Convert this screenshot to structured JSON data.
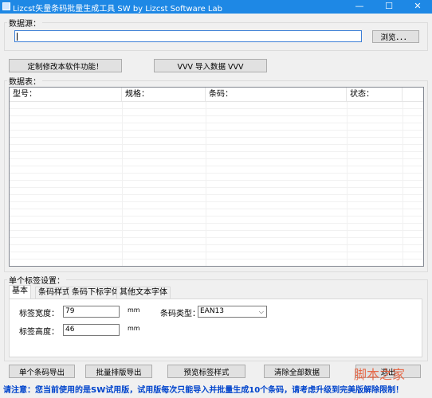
{
  "window": {
    "title": "Lizcst矢量条码批量生成工具 SW  by Lizcst Software Lab",
    "minimize_glyph": "—",
    "maximize_glyph": "☐",
    "close_glyph": "✕"
  },
  "source": {
    "group_label": "数据源：",
    "input_value": "",
    "browse_label": "浏览．．．"
  },
  "actions": {
    "customize_label": "定制修改本软件功能！",
    "import_label": "VVV  导入数据  VVV"
  },
  "data_table": {
    "group_label": "数据表：",
    "columns": [
      "型号：",
      "规格：",
      "条码：",
      "状态："
    ],
    "rows": []
  },
  "settings": {
    "group_label": "单个标签设置：",
    "tabs": [
      "基本",
      "条码样式",
      "条码下标字体",
      "其他文本字体"
    ],
    "active_tab": "基本",
    "width_label": "标签宽度：",
    "width_value": "79",
    "width_unit": "mm",
    "height_label": "标签高度：",
    "height_value": "46",
    "height_unit": "mm",
    "barcode_type_label": "条码类型：",
    "barcode_type_value": "EAN13"
  },
  "bottom_buttons": {
    "export_single": "单个条码导出",
    "export_batch": "批量排版导出",
    "preview_style": "预览标签样式",
    "clear_all": "清除全部数据",
    "exit": "退出"
  },
  "notice": "请注意：您当前使用的是SW试用版，试用版每次只能导入并批量生成10个条码，请考虑升级到完美版解除限制！",
  "watermark": "脚本之家"
}
